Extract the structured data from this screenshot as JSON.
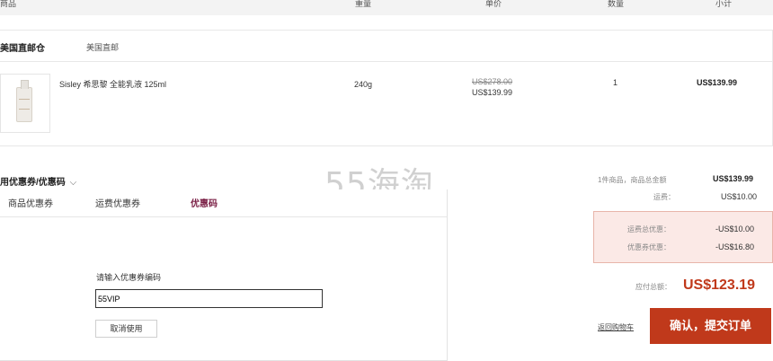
{
  "header": {
    "col_product": "商品",
    "col_weight": "重量",
    "col_unit_price": "单价",
    "col_quantity": "数量",
    "col_subtotal": "小计"
  },
  "warehouse": {
    "title": "美国直邮仓",
    "subtitle": "美国直邮"
  },
  "item": {
    "name": "Sisley 希思黎 全能乳液 125ml",
    "weight": "240g",
    "original_price": "US$278.00",
    "price": "US$139.99",
    "quantity": "1",
    "subtotal": "US$139.99",
    "thumb_icon": "lotion-bottle-icon"
  },
  "coupon": {
    "toggle_label": "用优惠券/优惠码",
    "tabs": [
      "商品优惠券",
      "运费优惠券",
      "优惠码"
    ],
    "active_tab": 2,
    "input_label": "请输入优惠券编码",
    "input_value": "55VIP",
    "cancel_label": "取消使用"
  },
  "watermark": "55海淘",
  "summary": {
    "items_label": "1件商品，商品总金额",
    "items_total": "US$139.99",
    "shipping_label": "运费：",
    "shipping_value": "US$10.00",
    "shipping_discount_label": "运费总优惠：",
    "shipping_discount_value": "-US$10.00",
    "coupon_discount_label": "优惠券优惠：",
    "coupon_discount_value": "-US$16.80",
    "payable_label": "应付总额：",
    "payable_value": "US$123.19",
    "back_link": "返回购物车",
    "submit_label": "确认，提交订单",
    "accent_color": "#c0391b"
  }
}
